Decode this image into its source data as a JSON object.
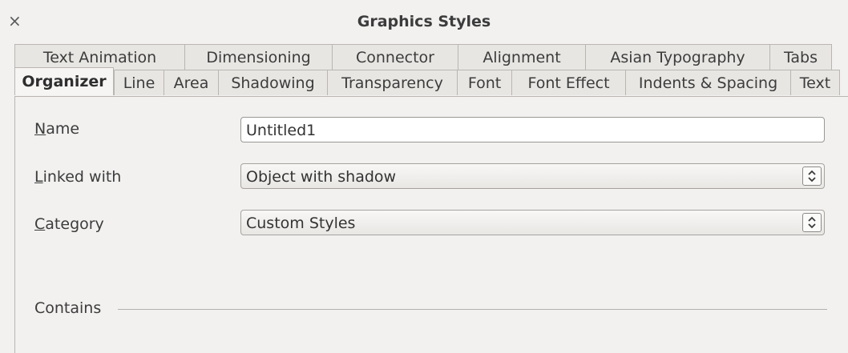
{
  "window": {
    "title": "Graphics Styles",
    "close_glyph": "×"
  },
  "tabs_row1": [
    "Text Animation",
    "Dimensioning",
    "Connector",
    "Alignment",
    "Asian Typography",
    "Tabs"
  ],
  "tabs_row2": [
    "Organizer",
    "Line",
    "Area",
    "Shadowing",
    "Transparency",
    "Font",
    "Font Effect",
    "Indents & Spacing",
    "Text"
  ],
  "active_tab": "Organizer",
  "form": {
    "name": {
      "label_first": "N",
      "label_rest": "ame",
      "value": "Untitled1"
    },
    "linked_with": {
      "label_first": "L",
      "label_rest": "inked with",
      "value": "Object with shadow"
    },
    "category": {
      "label_first": "C",
      "label_rest": "ategory",
      "value": "Custom Styles"
    }
  },
  "contains_heading": "Contains"
}
